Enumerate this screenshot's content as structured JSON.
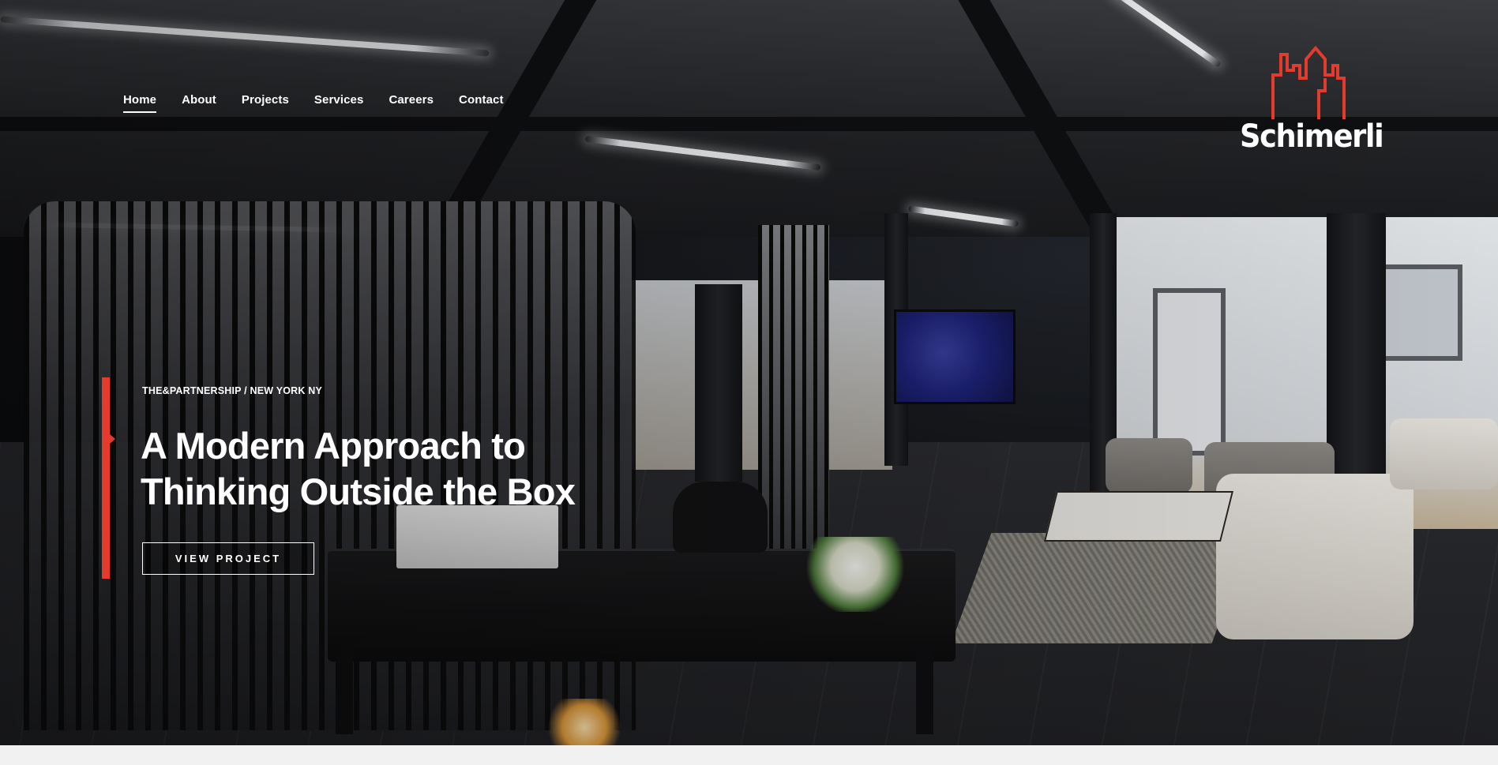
{
  "nav": {
    "items": [
      {
        "label": "Home",
        "active": true
      },
      {
        "label": "About",
        "active": false
      },
      {
        "label": "Projects",
        "active": false
      },
      {
        "label": "Services",
        "active": false
      },
      {
        "label": "Careers",
        "active": false
      },
      {
        "label": "Contact",
        "active": false
      }
    ]
  },
  "brand": {
    "name": "Schimerli",
    "logo_icon": "city-skyline-icon",
    "logo_color": "#e53b2c"
  },
  "hero": {
    "kicker": "THE&PARTNERSHIP / NEW YORK NY",
    "headline_line1": "A Modern Approach to",
    "headline_line2": "Thinking Outside the Box",
    "cta_label": "VIEW PROJECT",
    "accent_color": "#e53b2c"
  }
}
